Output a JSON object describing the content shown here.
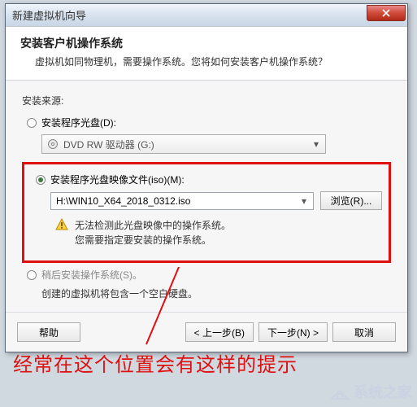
{
  "window": {
    "title": "新建虚拟机向导"
  },
  "header": {
    "title": "安装客户机操作系统",
    "subtitle": "虚拟机如同物理机，需要操作系统。您将如何安装客户机操作系统？"
  },
  "section_label": "安装来源:",
  "option_disc": {
    "label": "安装程序光盘(D):",
    "drive_text": "DVD RW 驱动器 (G:)"
  },
  "option_iso": {
    "label": "安装程序光盘映像文件(iso)(M):",
    "path": "H:\\WIN10_X64_2018_0312.iso",
    "browse": "浏览(R)...",
    "warn_line1": "无法检测此光盘映像中的操作系统。",
    "warn_line2": "您需要指定要安装的操作系统。"
  },
  "option_later": {
    "label": "稍后安装操作系统(S)。",
    "hint": "创建的虚拟机将包含一个空白硬盘。"
  },
  "buttons": {
    "help": "帮助",
    "back": "< 上一步(B)",
    "next": "下一步(N) >",
    "cancel": "取消"
  },
  "annotation": "经常在这个位置会有这样的提示",
  "watermark": "系统之家",
  "colors": {
    "highlight": "#e01010"
  }
}
